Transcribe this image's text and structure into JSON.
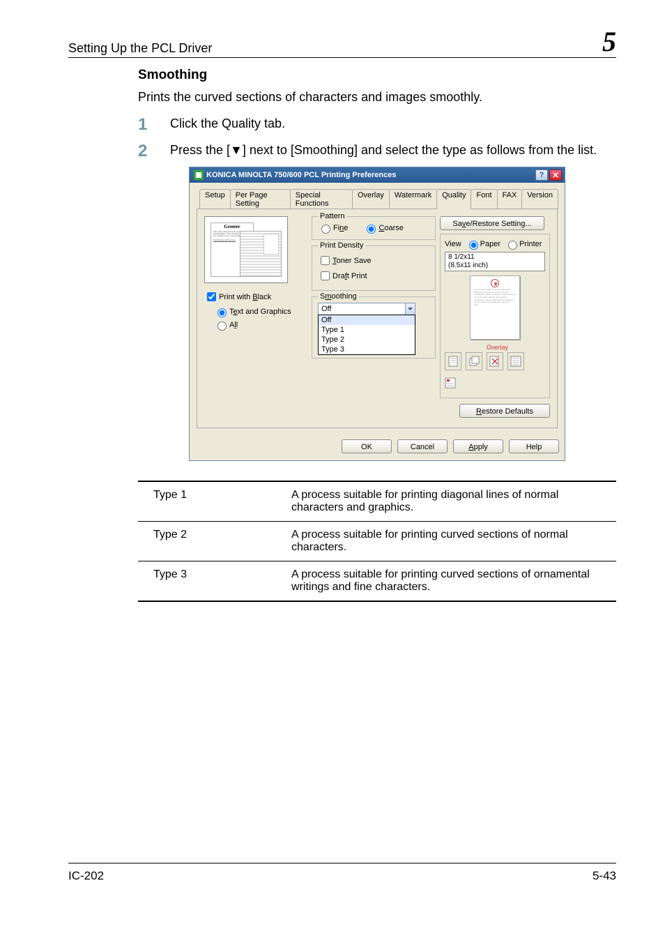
{
  "header": {
    "section": "Setting Up the PCL Driver",
    "chapter": "5"
  },
  "section": {
    "title": "Smoothing",
    "intro": "Prints the curved sections of characters and images smoothly."
  },
  "steps": [
    {
      "num": "1",
      "text": "Click the Quality tab."
    },
    {
      "num": "2",
      "text": "Press the [▼] next to [Smoothing] and select the type as follows from the list."
    }
  ],
  "dialog": {
    "title": "KONICA MINOLTA 750/600 PCL Printing Preferences",
    "tabs": {
      "setup": "Setup",
      "perpage": "Per Page Setting",
      "special": "Special Functions",
      "overlay": "Overlay",
      "watermark": "Watermark",
      "quality": "Quality",
      "font": "Font",
      "fax": "FAX",
      "version": "Version"
    },
    "pattern": {
      "group": "Pattern",
      "fine": "Fine",
      "coarse": "Coarse"
    },
    "density": {
      "group": "Print Density",
      "toner": "Toner Save",
      "draft": "Draft Print"
    },
    "pwb": {
      "label": "Print with Black",
      "opt1": "Text and Graphics",
      "opt2": "All"
    },
    "smoothing": {
      "group": "Smoothing",
      "selected": "Off",
      "options": {
        "o0": "Off",
        "o1": "Type 1",
        "o2": "Type 2",
        "o3": "Type 3"
      }
    },
    "right": {
      "save": "Save/Restore Setting...",
      "view": "View",
      "paper": "Paper",
      "printer": "Printer",
      "size1": "8 1/2x11",
      "size2": "(8.5x11 inch)",
      "overlay_label": "Overlay",
      "restore": "Restore Defaults"
    },
    "buttons": {
      "ok": "OK",
      "cancel": "Cancel",
      "apply": "Apply",
      "help": "Help"
    },
    "preview": {
      "greeter": "Greeter"
    }
  },
  "table": {
    "r1": {
      "c1": "Type 1",
      "c2": "A process suitable for printing diagonal lines of normal characters and graphics."
    },
    "r2": {
      "c1": "Type 2",
      "c2": "A process suitable for printing curved sections of normal characters."
    },
    "r3": {
      "c1": "Type 3",
      "c2": "A process suitable for printing curved sections of ornamental writings and fine characters."
    }
  },
  "footer": {
    "left": "IC-202",
    "right": "5-43"
  }
}
